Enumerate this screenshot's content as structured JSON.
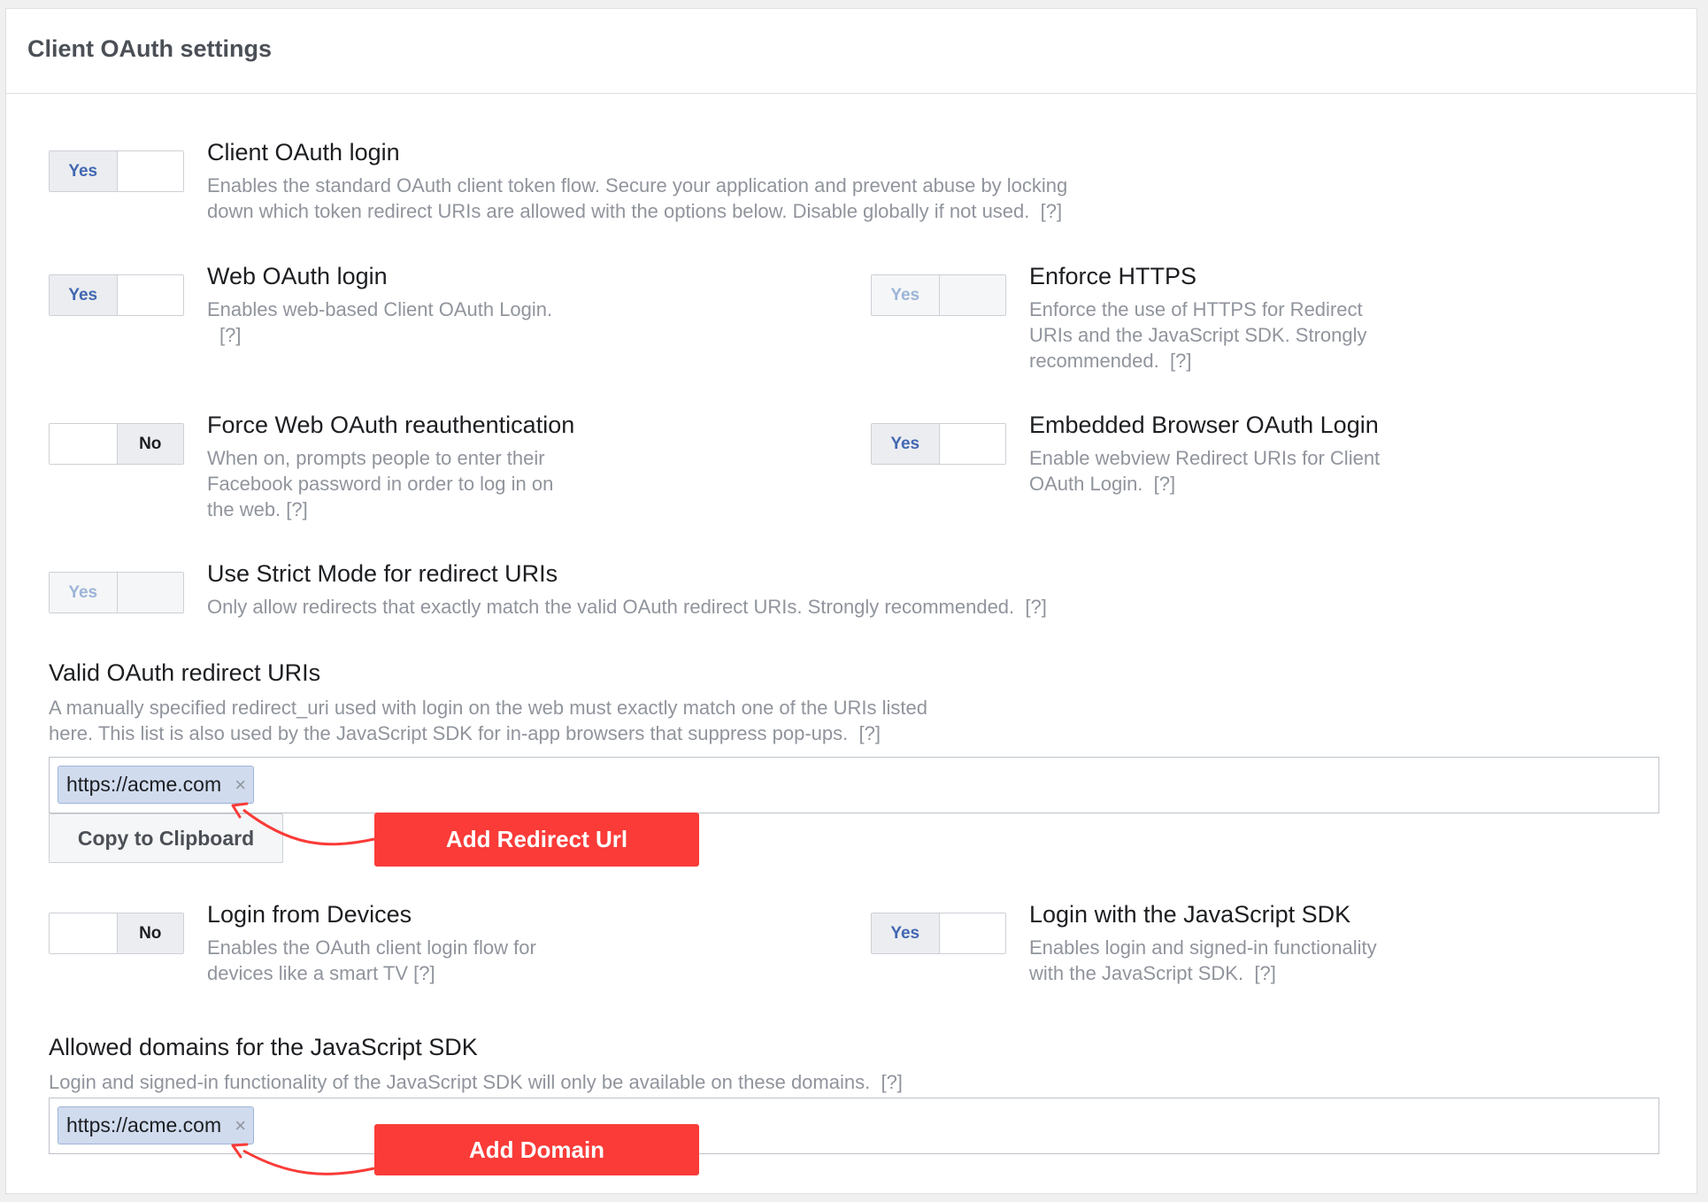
{
  "panel": {
    "title": "Client OAuth settings"
  },
  "settings": {
    "client_oauth_login": {
      "title": "Client OAuth login",
      "desc_line1": "Enables the standard OAuth client token flow. Secure your application and prevent abuse by locking",
      "desc_line2": "down which token redirect URIs are allowed with the options below. Disable globally if not used.",
      "help": "[?]",
      "toggle": {
        "yes": "Yes",
        "no": "",
        "state": "yes"
      }
    },
    "web_oauth_login": {
      "title": "Web OAuth login",
      "desc": "Enables web-based Client OAuth Login.",
      "help": "[?]",
      "toggle": {
        "yes": "Yes",
        "no": "",
        "state": "yes"
      }
    },
    "enforce_https": {
      "title": "Enforce HTTPS",
      "desc_line1": "Enforce the use of HTTPS for Redirect",
      "desc_line2": "URIs and the JavaScript SDK. Strongly",
      "desc_line3": "recommended.",
      "help": "[?]",
      "toggle": {
        "yes": "Yes",
        "no": "",
        "state": "yes-disabled"
      }
    },
    "force_reauth": {
      "title": "Force Web OAuth reauthentication",
      "desc_line1": "When on, prompts people to enter their",
      "desc_line2": "Facebook password in order to log in on",
      "desc_line3": "the web.",
      "help": "[?]",
      "toggle": {
        "yes": "",
        "no": "No",
        "state": "no"
      }
    },
    "embedded_browser": {
      "title": "Embedded Browser OAuth Login",
      "desc_line1": "Enable webview Redirect URIs for Client",
      "desc_line2": "OAuth Login.",
      "help": "[?]",
      "toggle": {
        "yes": "Yes",
        "no": "",
        "state": "yes"
      }
    },
    "strict_mode": {
      "title": "Use Strict Mode for redirect URIs",
      "desc": "Only allow redirects that exactly match the valid OAuth redirect URIs. Strongly recommended.",
      "help": "[?]",
      "toggle": {
        "yes": "Yes",
        "no": "",
        "state": "yes-disabled"
      }
    },
    "login_devices": {
      "title": "Login from Devices",
      "desc_line1": "Enables the OAuth client login flow for",
      "desc_line2": "devices like a smart TV",
      "help": "[?]",
      "toggle": {
        "yes": "",
        "no": "No",
        "state": "no"
      }
    },
    "login_js_sdk": {
      "title": "Login with the JavaScript SDK",
      "desc_line1": "Enables login and signed-in functionality",
      "desc_line2": "with the JavaScript SDK.",
      "help": "[?]",
      "toggle": {
        "yes": "Yes",
        "no": "",
        "state": "yes"
      }
    }
  },
  "redirect_uris": {
    "title": "Valid OAuth redirect URIs",
    "desc_line1": "A manually specified redirect_uri used with login on the web must exactly match one of the URIs listed",
    "desc_line2": "here. This list is also used by the JavaScript SDK for in-app browsers that suppress pop-ups.",
    "help": "[?]",
    "tokens": [
      "https://acme.com"
    ],
    "copy_button": "Copy to Clipboard",
    "callout": "Add Redirect Url"
  },
  "allowed_domains": {
    "title": "Allowed domains for the JavaScript SDK",
    "desc": "Login and signed-in functionality of the JavaScript SDK will only be available on these domains.",
    "help": "[?]",
    "tokens": [
      "https://acme.com"
    ],
    "callout": "Add Domain"
  },
  "icons": {
    "remove": "×"
  },
  "colors": {
    "accent": "#4267b2",
    "callout": "#fa3b38",
    "token_bg": "#d0dbee"
  }
}
